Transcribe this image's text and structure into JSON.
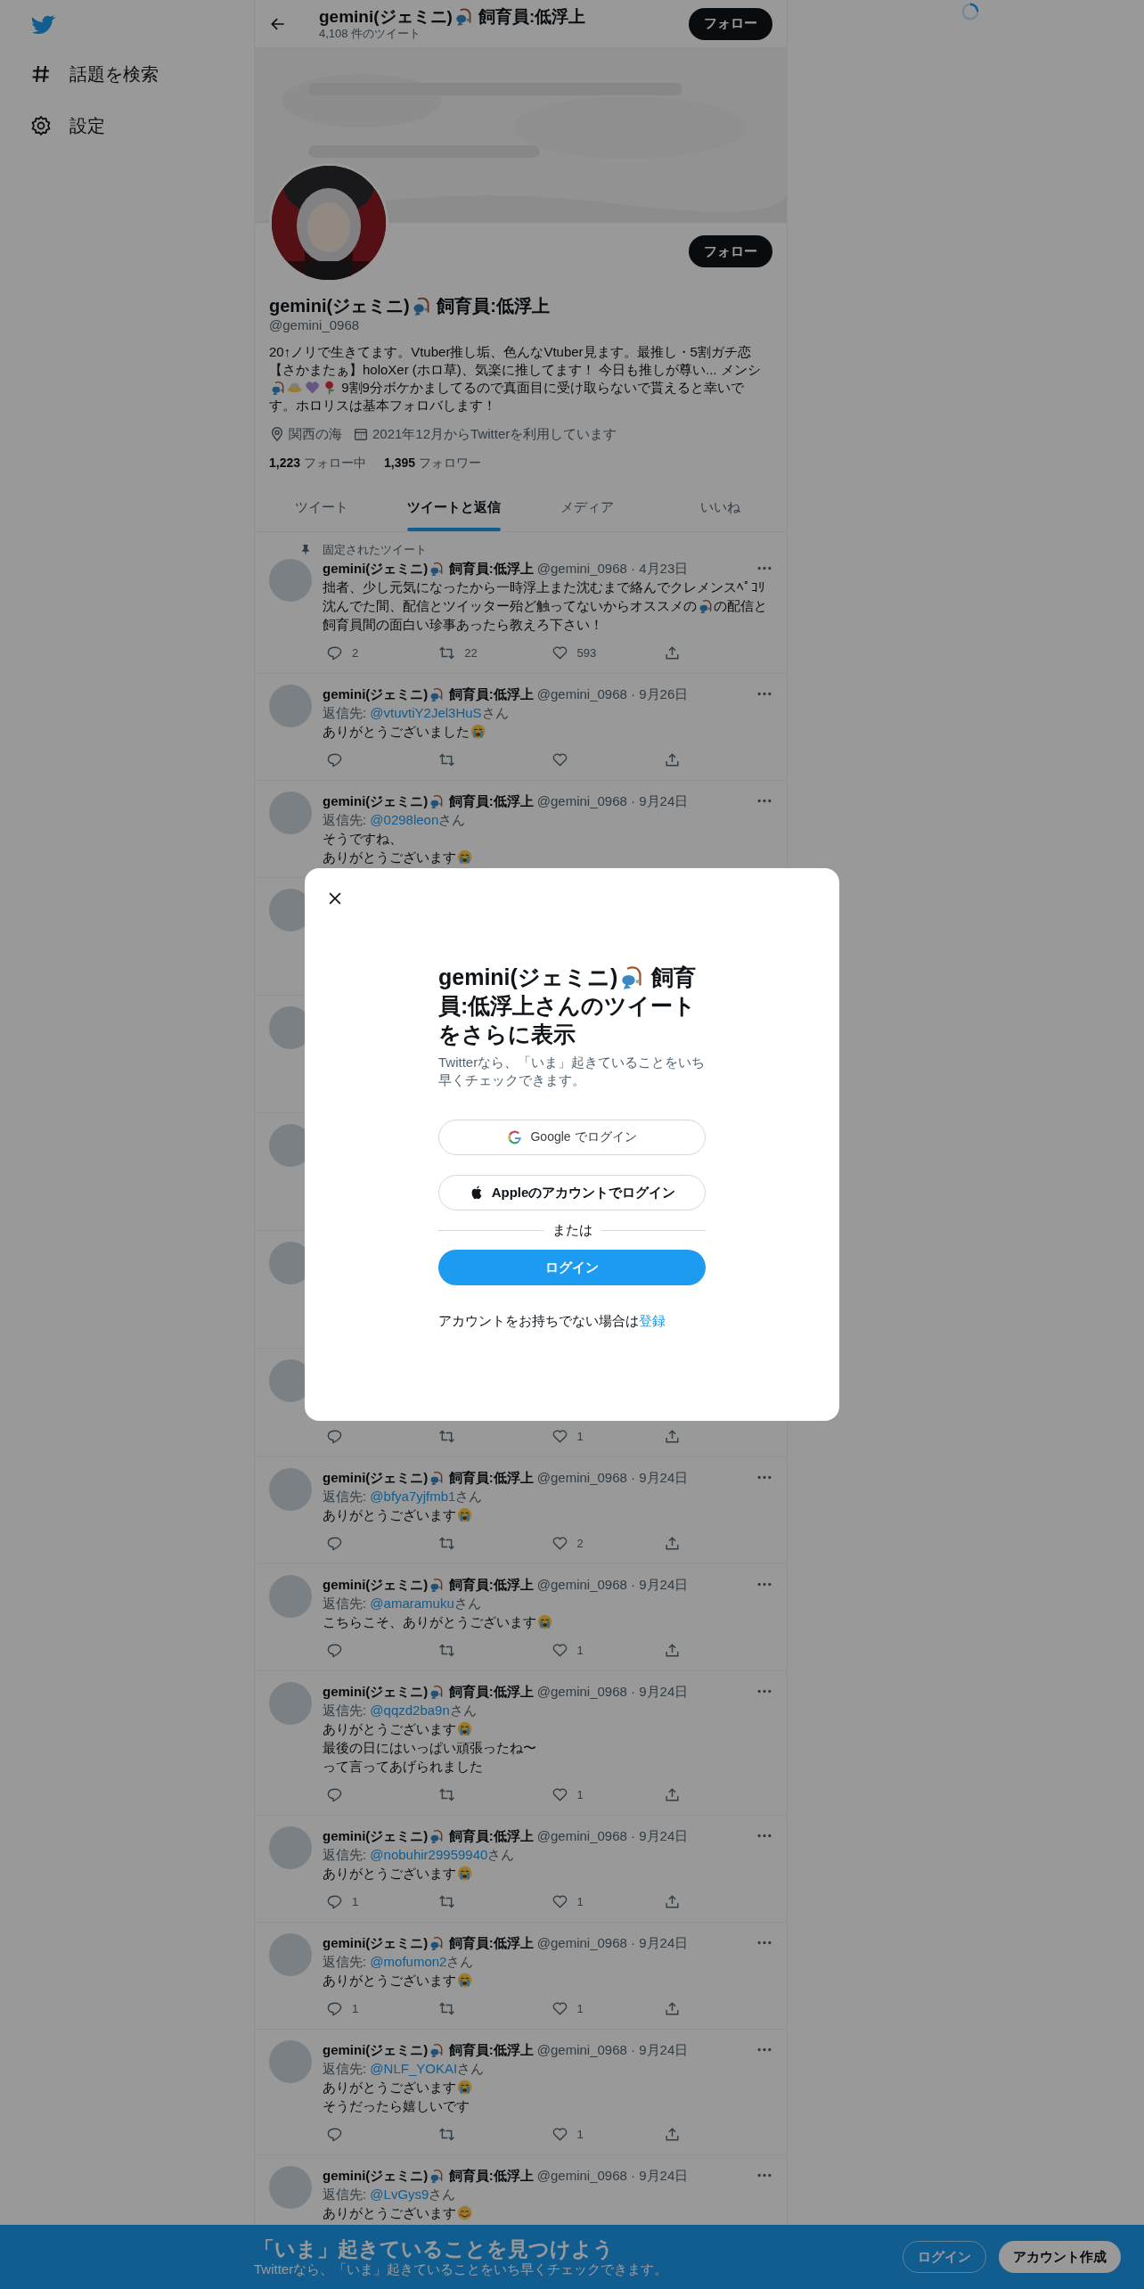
{
  "sidebar": {
    "items": [
      {
        "label": "話題を検索",
        "kind": "explore"
      },
      {
        "label": "設定",
        "kind": "settings"
      }
    ]
  },
  "header": {
    "name": [
      {
        "text": "gemini(ジェミニ)"
      },
      {
        "kind": "fishing"
      },
      {
        "text": " 飼育員:低浮上"
      }
    ],
    "tweet_count": "4,108 件のツイート",
    "follow_button": "フォロー"
  },
  "profile": {
    "follow_button": "フォロー",
    "name": [
      {
        "text": "gemini(ジェミニ)"
      },
      {
        "kind": "fishing"
      },
      {
        "text": " 飼育員:低浮上"
      }
    ],
    "handle": "@gemini_0968",
    "bio": [
      [
        {
          "text": "20↑ノリで生きてます。Vtuber推し垢、色んなVtuber見ます。最推し・5割ガチ恋"
        }
      ],
      [
        {
          "text": "【さかまたぁ】holoXer (ホロ草)、気楽に推してます！ 今日も推しが尊い... メンシ"
        }
      ],
      [
        {
          "kind": "fishing"
        },
        {
          "kind": "ufo"
        },
        {
          "kind": "purple_heart"
        },
        {
          "kind": "flower"
        },
        {
          "text": " 9割9分ボケかましてるので真面目に受け取らないで貰えると幸いで"
        }
      ],
      [
        {
          "text": "す。ホロリスは基本フォロバします！"
        }
      ]
    ],
    "location": "関西の海",
    "joined": "2021年12月からTwitterを利用しています",
    "following_count": "1,223",
    "following_label": "フォロー中",
    "followers_count": "1,395",
    "followers_label": "フォロワー"
  },
  "tabs": [
    {
      "label": "ツイート",
      "selected": false
    },
    {
      "label": "ツイートと返信",
      "selected": true
    },
    {
      "label": "メディア",
      "selected": false
    },
    {
      "label": "いいね",
      "selected": false
    }
  ],
  "tweets": [
    {
      "kind": "tweet",
      "pinned_label": "固定されたツイート",
      "author": [
        {
          "text": "gemini(ジェミニ)"
        },
        {
          "kind": "fishing"
        },
        {
          "text": " 飼育員:低浮上"
        }
      ],
      "meta": "@gemini_0968 · 4月23日",
      "lines": [
        [
          {
            "text": "拙者、少し元気になったから一時浮上また沈むまで絡んでクレメンスﾍﾟｺﾘ"
          }
        ],
        [
          {
            "text": "沈んでた間、配信とツイッター殆ど触ってないからオススメの"
          },
          {
            "kind": "fishing"
          },
          {
            "text": "の配信と"
          }
        ],
        [
          {
            "text": "飼育員間の面白い珍事あったら教えろ下さい！"
          }
        ]
      ],
      "actions": true,
      "replies": "2",
      "retweets": "22",
      "likes": "593"
    },
    {
      "kind": "tweet",
      "author": [
        {
          "text": "gemini(ジェミニ)"
        },
        {
          "kind": "fishing"
        },
        {
          "text": " 飼育員:低浮上"
        }
      ],
      "meta": "@gemini_0968 · 9月26日",
      "reply_prefix": "返信先: ",
      "reply_to": "@vtuvtiY2Jel3HuS",
      "reply_suffix": "さん",
      "lines": [
        [
          {
            "text": "ありがとうございました"
          },
          {
            "kind": "crying"
          }
        ]
      ],
      "actions": true
    },
    {
      "kind": "tweet",
      "author": [
        {
          "text": "gemini(ジェミニ)"
        },
        {
          "kind": "fishing"
        },
        {
          "text": " 飼育員:低浮上"
        }
      ],
      "meta": "@gemini_0968 · 9月24日",
      "reply_prefix": "返信先: ",
      "reply_to": "@0298leon",
      "reply_suffix": "さん",
      "lines": [
        [
          {
            "text": "そうですね、"
          }
        ],
        [
          {
            "text": "ありがとうございます"
          },
          {
            "kind": "crying"
          }
        ]
      ],
      "actions": false
    },
    {
      "kind": "covered",
      "actions": false
    },
    {
      "kind": "covered",
      "actions": false
    },
    {
      "kind": "covered",
      "actions": false
    },
    {
      "kind": "covered",
      "actions": false
    },
    {
      "kind": "covered",
      "actions": true,
      "likes": "1"
    },
    {
      "kind": "tweet",
      "author": [
        {
          "text": "gemini(ジェミニ)"
        },
        {
          "kind": "fishing"
        },
        {
          "text": " 飼育員:低浮上"
        }
      ],
      "meta": "@gemini_0968 · 9月24日",
      "reply_prefix": "返信先: ",
      "reply_to": "@bfya7yjfmb1",
      "reply_suffix": "さん",
      "lines": [
        [
          {
            "text": "ありがとうございます"
          },
          {
            "kind": "crying"
          }
        ]
      ],
      "actions": true,
      "likes": "2"
    },
    {
      "kind": "tweet",
      "author": [
        {
          "text": "gemini(ジェミニ)"
        },
        {
          "kind": "fishing"
        },
        {
          "text": " 飼育員:低浮上"
        }
      ],
      "meta": "@gemini_0968 · 9月24日",
      "reply_prefix": "返信先: ",
      "reply_to": "@amaramuku",
      "reply_suffix": "さん",
      "lines": [
        [
          {
            "text": "こちらこそ、ありがとうございます"
          },
          {
            "kind": "crying"
          }
        ]
      ],
      "actions": true,
      "likes": "1"
    },
    {
      "kind": "tweet",
      "author": [
        {
          "text": "gemini(ジェミニ)"
        },
        {
          "kind": "fishing"
        },
        {
          "text": " 飼育員:低浮上"
        }
      ],
      "meta": "@gemini_0968 · 9月24日",
      "reply_prefix": "返信先: ",
      "reply_to": "@qqzd2ba9n",
      "reply_suffix": "さん",
      "lines": [
        [
          {
            "text": "ありがとうございます"
          },
          {
            "kind": "crying"
          }
        ],
        [
          {
            "text": "最後の日にはいっぱい頑張ったね〜"
          }
        ],
        [
          {
            "text": "って言ってあげられました"
          }
        ]
      ],
      "actions": true,
      "likes": "1"
    },
    {
      "kind": "tweet",
      "author": [
        {
          "text": "gemini(ジェミニ)"
        },
        {
          "kind": "fishing"
        },
        {
          "text": " 飼育員:低浮上"
        }
      ],
      "meta": "@gemini_0968 · 9月24日",
      "reply_prefix": "返信先: ",
      "reply_to": "@nobuhir29959940",
      "reply_suffix": "さん",
      "lines": [
        [
          {
            "text": "ありがとうございます"
          },
          {
            "kind": "crying"
          }
        ]
      ],
      "actions": true,
      "replies": "1",
      "likes": "1"
    },
    {
      "kind": "tweet",
      "author": [
        {
          "text": "gemini(ジェミニ)"
        },
        {
          "kind": "fishing"
        },
        {
          "text": " 飼育員:低浮上"
        }
      ],
      "meta": "@gemini_0968 · 9月24日",
      "reply_prefix": "返信先: ",
      "reply_to": "@mofumon2",
      "reply_suffix": "さん",
      "lines": [
        [
          {
            "text": "ありがとうございます"
          },
          {
            "kind": "crying"
          }
        ]
      ],
      "actions": true,
      "replies": "1",
      "likes": "1"
    },
    {
      "kind": "tweet",
      "author": [
        {
          "text": "gemini(ジェミニ)"
        },
        {
          "kind": "fishing"
        },
        {
          "text": " 飼育員:低浮上"
        }
      ],
      "meta": "@gemini_0968 · 9月24日",
      "reply_prefix": "返信先: ",
      "reply_to": "@NLF_YOKAI",
      "reply_suffix": "さん",
      "lines": [
        [
          {
            "text": "ありがとうございます"
          },
          {
            "kind": "crying"
          }
        ],
        [
          {
            "text": "そうだったら嬉しいです"
          }
        ]
      ],
      "actions": true,
      "likes": "1"
    },
    {
      "kind": "tweet",
      "author": [
        {
          "text": "gemini(ジェミニ)"
        },
        {
          "kind": "fishing"
        },
        {
          "text": " 飼育員:低浮上"
        }
      ],
      "meta": "@gemini_0968 · 9月24日",
      "reply_prefix": "返信先: ",
      "reply_to": "@LvGys9",
      "reply_suffix": "さん",
      "lines": [
        [
          {
            "text": "ありがとうございます"
          },
          {
            "kind": "smiling"
          }
        ]
      ],
      "actions": false
    }
  ],
  "modal": {
    "title": [
      [
        {
          "text": "gemini(ジェミニ)"
        },
        {
          "kind": "fishing"
        },
        {
          "text": " 飼育"
        }
      ],
      [
        {
          "text": "員:低浮上さんのツイート"
        }
      ],
      [
        {
          "text": "をさらに表示"
        }
      ]
    ],
    "subtitle": "Twitterなら、「いま」起きていることをいち早くチェックできます。",
    "google_button": "Google でログイン",
    "apple_button": "Appleのアカウントでログイン",
    "divider": "または",
    "login_button": "ログイン",
    "signup_prompt": "アカウントをお持ちでない場合は",
    "signup_link": "登録"
  },
  "bottom_bar": {
    "title": "「いま」起きていることを見つけよう",
    "subtitle": "Twitterなら、「いま」起きていることをいち早くチェックできます。",
    "login_button": "ログイン",
    "signup_button": "アカウント作成"
  }
}
